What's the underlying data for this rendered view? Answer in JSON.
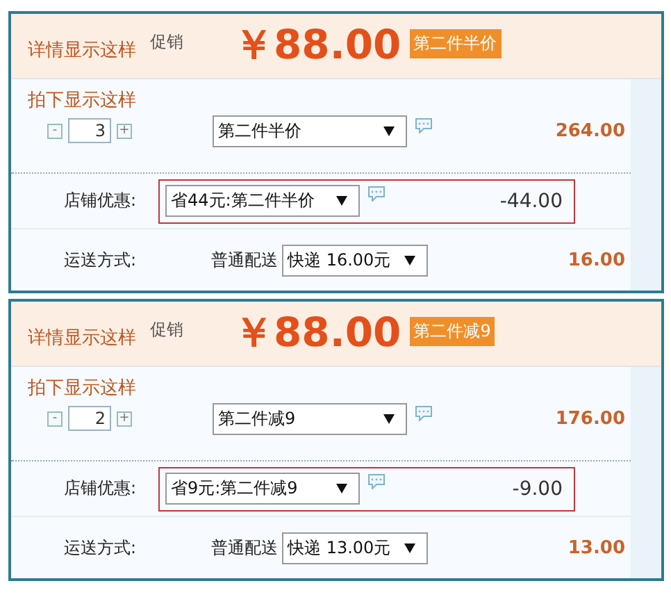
{
  "panels": [
    {
      "header": {
        "label": "详情显示这样",
        "promo_label": "促销",
        "price": "￥88.00",
        "badge": "第二件半价"
      },
      "item": {
        "label": "拍下显示这样",
        "decrement": "-",
        "quantity": "3",
        "increment": "+",
        "promotion": "第二件半价",
        "subtotal": "264.00"
      },
      "discount": {
        "label": "店铺优惠:",
        "selection": "省44元:第二件半价",
        "amount": "-44.00"
      },
      "shipping": {
        "label": "运送方式:",
        "method": "普通配送",
        "selection": "快递 16.00元",
        "cost": "16.00"
      }
    },
    {
      "header": {
        "label": "详情显示这样",
        "promo_label": "促销",
        "price": "￥88.00",
        "badge": "第二件减9"
      },
      "item": {
        "label": "拍下显示这样",
        "decrement": "-",
        "quantity": "2",
        "increment": "+",
        "promotion": "第二件减9",
        "subtotal": "176.00"
      },
      "discount": {
        "label": "店铺优惠:",
        "selection": "省9元:第二件减9",
        "amount": "-9.00"
      },
      "shipping": {
        "label": "运送方式:",
        "method": "普通配送",
        "selection": "快递 13.00元",
        "cost": "13.00"
      }
    }
  ]
}
